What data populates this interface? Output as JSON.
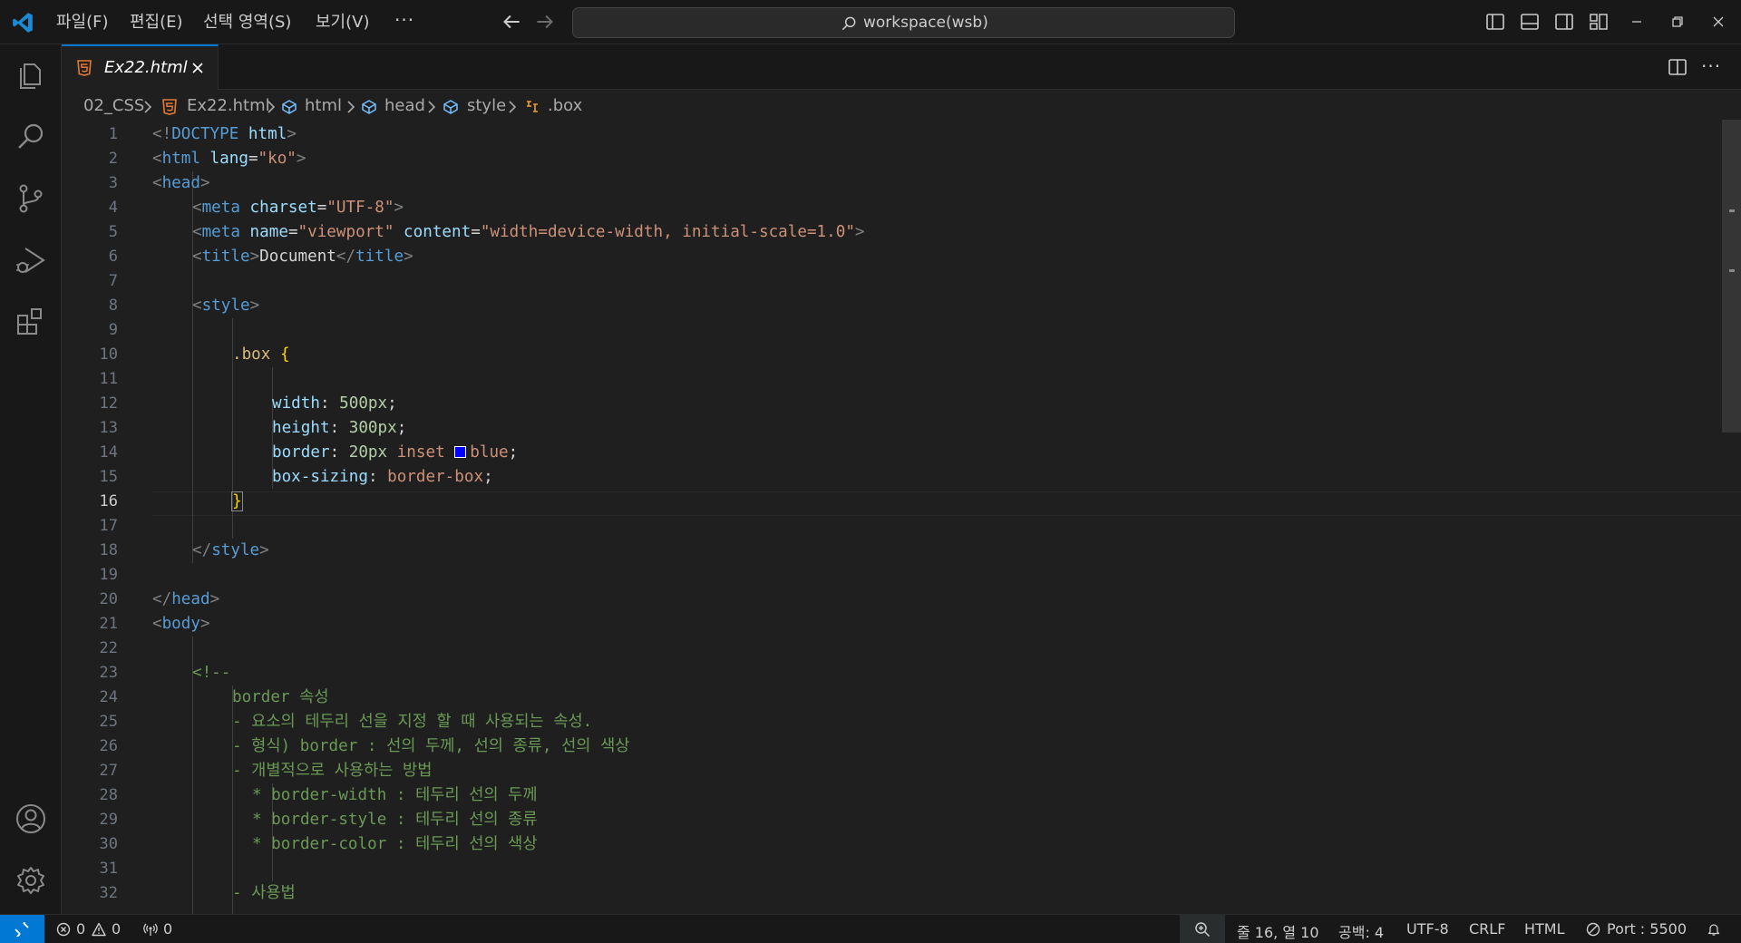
{
  "menu": {
    "file": "파일(F)",
    "edit": "편집(E)",
    "selection": "선택 영역(S)",
    "view": "보기(V)",
    "more": "···"
  },
  "command_center": {
    "text": "workspace(wsb)"
  },
  "tabs": [
    {
      "label": "Ex22.html",
      "italic": true,
      "active": true
    }
  ],
  "tab_actions": {
    "more": "···"
  },
  "breadcrumb": {
    "folder": "02_CSS",
    "file": "Ex22.html",
    "items": [
      "html",
      "head",
      "style",
      ".box"
    ]
  },
  "editor": {
    "active_line": 16,
    "line_numbers": [
      "1",
      "2",
      "3",
      "4",
      "5",
      "6",
      "7",
      "8",
      "9",
      "10",
      "11",
      "12",
      "13",
      "14",
      "15",
      "16",
      "17",
      "18",
      "19",
      "20",
      "21",
      "22",
      "23",
      "24",
      "25",
      "26",
      "27",
      "28",
      "29",
      "30",
      "31",
      "32"
    ],
    "lines": [
      "<!DOCTYPE html>",
      "<html lang=\"ko\">",
      "<head>",
      "    <meta charset=\"UTF-8\">",
      "    <meta name=\"viewport\" content=\"width=device-width, initial-scale=1.0\">",
      "    <title>Document</title>",
      "",
      "    <style>",
      "",
      "        .box {",
      "",
      "            width: 500px;",
      "            height: 300px;",
      "            border: 20px inset blue;",
      "            box-sizing: border-box;",
      "        }",
      "",
      "    </style>",
      "",
      "</head>",
      "<body>",
      "",
      "    <!--",
      "        border 속성",
      "        - 요소의 테두리 선을 지정 할 때 사용되는 속성.",
      "        - 형식) border : 선의 두께, 선의 종류, 선의 색상",
      "        - 개별적으로 사용하는 방법",
      "          * border-width : 테두리 선의 두께",
      "          * border-style : 테두리 선의 종류",
      "          * border-color : 테두리 선의 색상",
      "",
      "        - 사용법"
    ],
    "tokens": {
      "l1": {
        "a": "<!",
        "b": "DOCTYPE",
        "c": " html",
        "d": ">"
      },
      "l2": {
        "a": "<",
        "b": "html",
        "c": " lang",
        "d": "=",
        "e": "\"ko\"",
        "f": ">"
      },
      "l3": {
        "a": "<",
        "b": "head",
        "c": ">"
      },
      "l4": {
        "a": "<",
        "b": "meta",
        "c": " charset",
        "d": "=",
        "e": "\"UTF-8\"",
        "f": ">"
      },
      "l5": {
        "a": "<",
        "b": "meta",
        "c": " name",
        "d": "=",
        "e": "\"viewport\"",
        "f": " content",
        "g": "=",
        "h": "\"width=device-width, initial-scale=1.0\"",
        "i": ">"
      },
      "l6": {
        "a": "<",
        "b": "title",
        "c": ">",
        "d": "Document",
        "e": "</",
        "f": "title",
        "g": ">"
      },
      "l8": {
        "a": "<",
        "b": "style",
        "c": ">"
      },
      "l10": {
        "a": ".box",
        "b": "{"
      },
      "l12": {
        "a": "width",
        "b": ": ",
        "c": "500px",
        "d": ";"
      },
      "l13": {
        "a": "height",
        "b": ": ",
        "c": "300px",
        "d": ";"
      },
      "l14": {
        "a": "border",
        "b": ": ",
        "c": "20px",
        "d": " inset ",
        "e": "blue",
        "f": ";"
      },
      "l15": {
        "a": "box-sizing",
        "b": ": ",
        "c": "border-box",
        "d": ";"
      },
      "l16": {
        "a": "}"
      },
      "l18": {
        "a": "</",
        "b": "style",
        "c": ">"
      },
      "l20": {
        "a": "</",
        "b": "head",
        "c": ">"
      },
      "l21": {
        "a": "<",
        "b": "body",
        "c": ">"
      },
      "l23": "<!--",
      "l24": "border 속성",
      "l25": "- 요소의 테두리 선을 지정 할 때 사용되는 속성.",
      "l26": "- 형식) border : 선의 두께, 선의 종류, 선의 색상",
      "l27": "- 개별적으로 사용하는 방법",
      "l28": "* border-width : 테두리 선의 두께",
      "l29": "* border-style : 테두리 선의 종류",
      "l30": "* border-color : 테두리 선의 색상",
      "l32": "- 사용법"
    }
  },
  "statusbar": {
    "errors": "0",
    "warnings": "0",
    "ports_forwarded": "0",
    "cursor_position": "줄 16, 열 10",
    "indentation": "공백: 4",
    "encoding": "UTF-8",
    "eol": "CRLF",
    "language": "HTML",
    "live_server": "Port : 5500"
  },
  "colors": {
    "accent": "#0078d4",
    "background": "#1f1f1f",
    "chrome": "#181818",
    "html_file_icon": "#e37933",
    "breadcrumb_symbol": "#75beff",
    "breadcrumb_class_symbol": "#ee9d28",
    "swatch_blue": "#0000ff"
  },
  "icons": {
    "logo": "vscode-logo",
    "activity": [
      "explorer-icon",
      "search-icon",
      "source-control-icon",
      "run-debug-icon",
      "extensions-icon",
      "account-icon",
      "settings-gear-icon"
    ],
    "title_right": [
      "toggle-primary-sidebar-icon",
      "toggle-panel-icon",
      "toggle-secondary-sidebar-icon",
      "customize-layout-icon"
    ],
    "window": [
      "minimize-icon",
      "restore-icon",
      "close-icon"
    ]
  }
}
